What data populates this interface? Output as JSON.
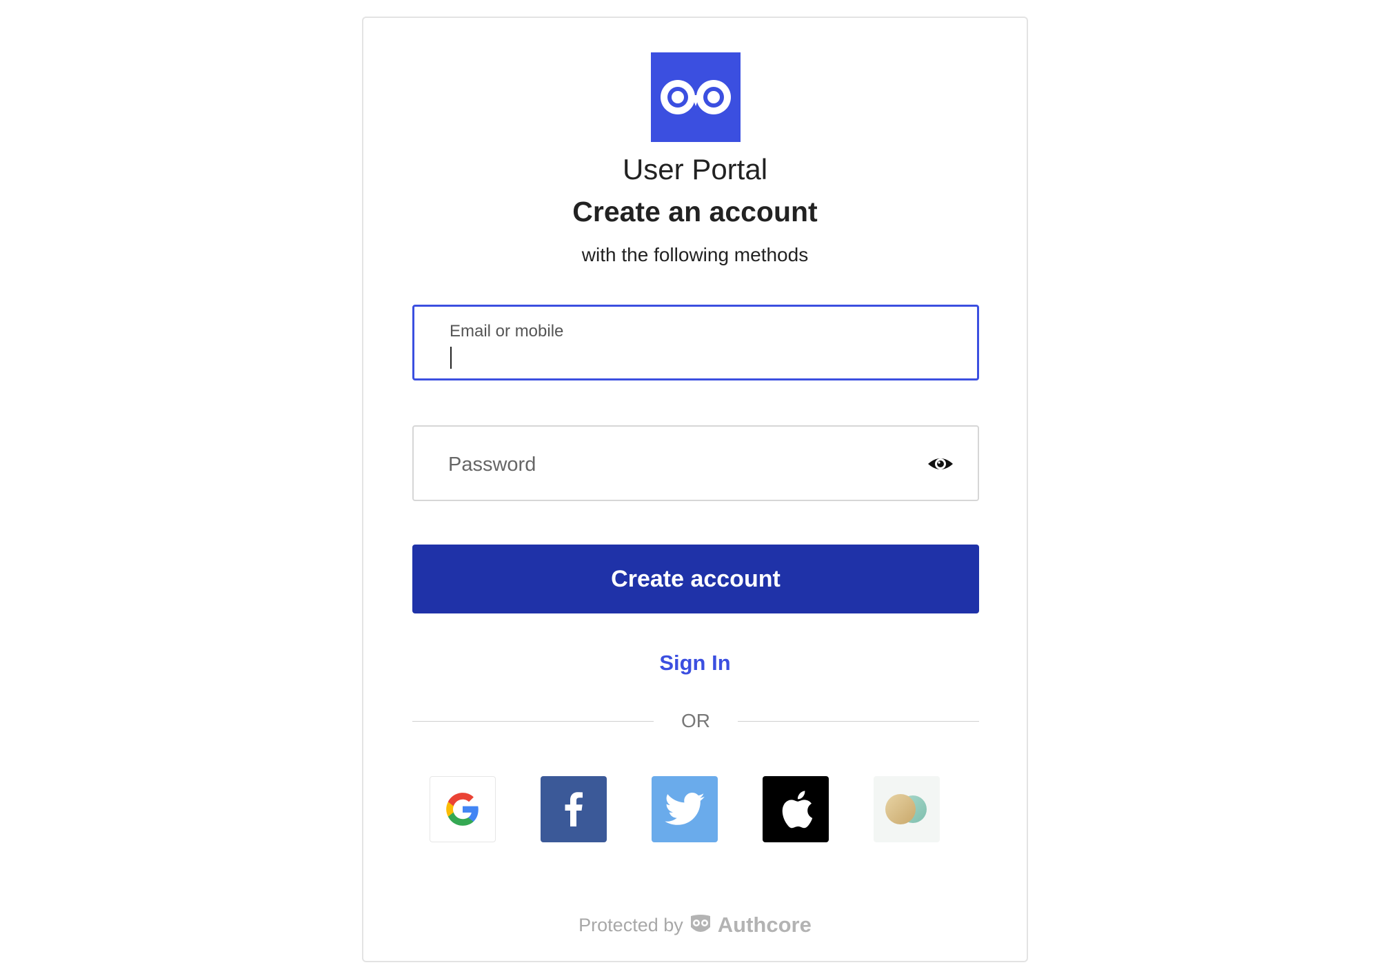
{
  "app": {
    "name": "User Portal",
    "brand_color": "#3b4fe0",
    "logo_icon": "owl-logo-icon"
  },
  "header": {
    "title": "Create an account",
    "subtitle": "with the following methods"
  },
  "form": {
    "email": {
      "label": "Email or mobile",
      "value": "",
      "focused": true
    },
    "password": {
      "placeholder": "Password",
      "value": "",
      "toggle_icon": "eye-icon"
    },
    "submit_label": "Create account",
    "submit_color": "#1f32a8"
  },
  "links": {
    "sign_in": "Sign In"
  },
  "divider": {
    "text": "OR"
  },
  "social_providers": [
    {
      "name": "google",
      "icon": "google-icon",
      "color": "#ffffff"
    },
    {
      "name": "facebook",
      "icon": "facebook-icon",
      "color": "#3b5998"
    },
    {
      "name": "twitter",
      "icon": "twitter-icon",
      "color": "#6aabeb"
    },
    {
      "name": "apple",
      "icon": "apple-icon",
      "color": "#000000"
    },
    {
      "name": "matters",
      "icon": "matters-icon",
      "color": "#f3f6f4"
    }
  ],
  "footer": {
    "protected_text": "Protected by",
    "brand": "Authcore",
    "brand_icon": "authcore-owl-icon"
  }
}
